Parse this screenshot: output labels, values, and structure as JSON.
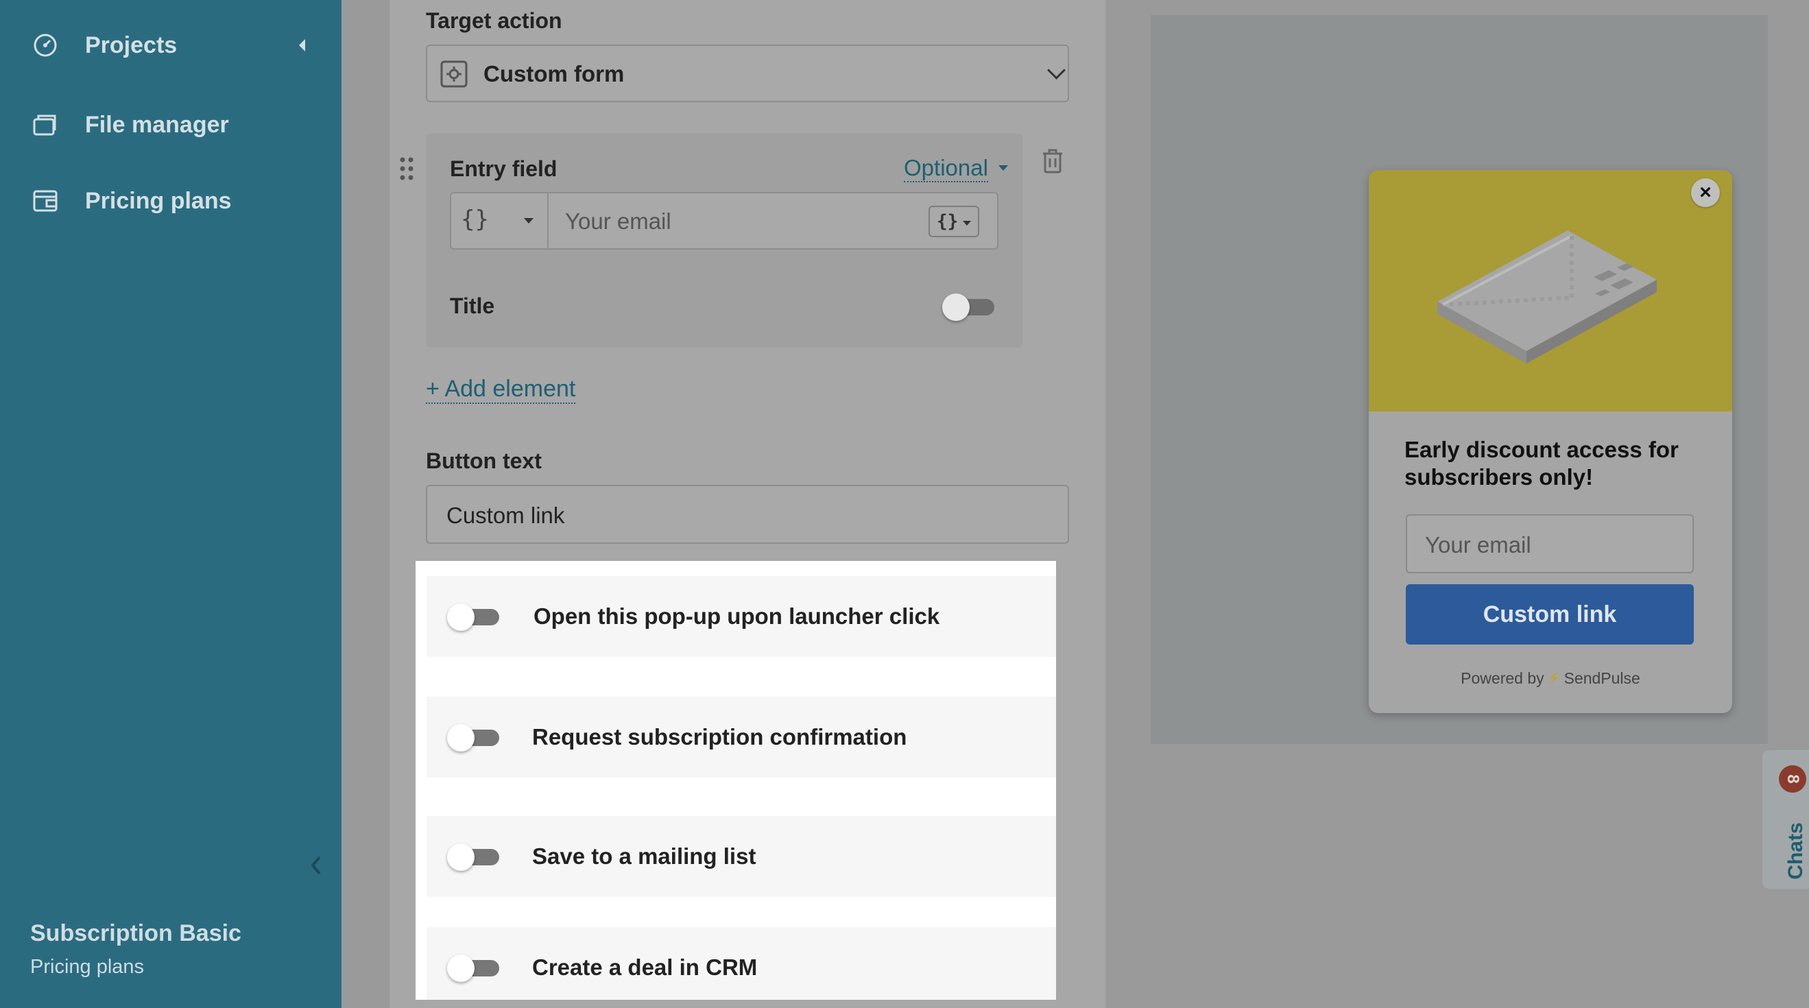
{
  "sidebar": {
    "items": [
      {
        "label": "Projects",
        "icon": "projects-icon"
      },
      {
        "label": "File manager",
        "icon": "folder-icon"
      },
      {
        "label": "Pricing plans",
        "icon": "wallet-icon"
      }
    ],
    "plan": {
      "name": "Subscription Basic",
      "subtitle": "Pricing plans"
    }
  },
  "editor": {
    "target_action_label": "Target action",
    "target_action_value": "Custom form",
    "entry_field": {
      "label": "Entry field",
      "requirement": "Optional",
      "placeholder": "Your email",
      "title_label": "Title",
      "title_enabled": false
    },
    "add_element": "+ Add element",
    "button_text_label": "Button text",
    "button_text_value": "Custom link",
    "options": [
      {
        "label": "Open this pop-up upon launcher click",
        "enabled": false
      },
      {
        "label": "Request subscription confirmation",
        "enabled": false
      },
      {
        "label": "Save to a mailing list",
        "enabled": false
      },
      {
        "label": "Create a deal in CRM",
        "enabled": false
      }
    ]
  },
  "preview": {
    "heading": "Early discount access for subscribers only!",
    "email_placeholder": "Your email",
    "button_label": "Custom link",
    "powered_prefix": "Powered by",
    "powered_brand": "SendPulse",
    "accent_color": "#2d5a9a",
    "hero_color": "#a99b36"
  },
  "chats": {
    "label": "Chats",
    "count": "8"
  }
}
